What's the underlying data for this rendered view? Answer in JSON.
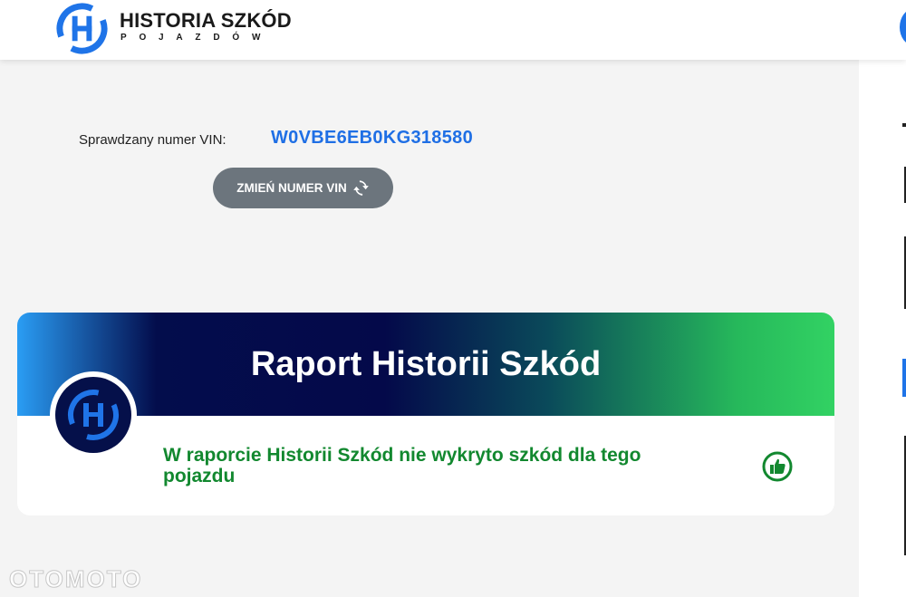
{
  "header": {
    "logo_title": "HISTORIA SZKÓD",
    "logo_subtitle": "POJAZDÓW"
  },
  "vin": {
    "label": "Sprawdzany numer VIN:",
    "value": "W0VBE6EB0KG318580",
    "change_button_label": "ZMIEŃ NUMER VIN"
  },
  "report": {
    "title": "Raport Historii Szkód",
    "result": "W raporcie Historii Szkód nie wykryto szkód dla tego pojazdu",
    "result_icon": "thumbs-up-icon"
  },
  "watermark": "OTOMOTO",
  "colors": {
    "accent_blue": "#1f6fe5",
    "success_green": "#12882f",
    "button_gray": "#6c757d",
    "header_navy": "#04094a"
  }
}
